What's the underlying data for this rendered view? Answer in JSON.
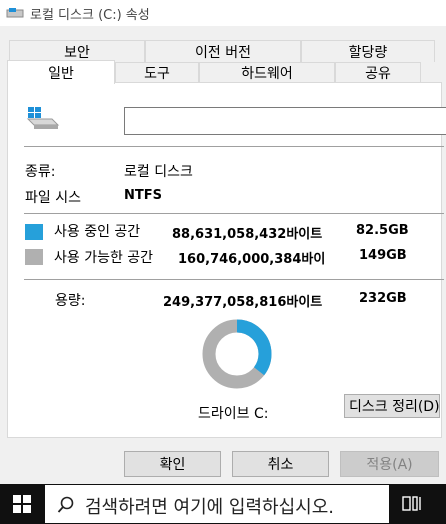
{
  "window": {
    "title": "로컬 디스크 (C:) 속성"
  },
  "tabs_back": [
    "보안",
    "이전 버전",
    "할당량"
  ],
  "tabs_front": [
    "일반",
    "도구",
    "하드웨어",
    "공유"
  ],
  "general": {
    "name_value": "",
    "type_label": "종류:",
    "type_value": "로컬 디스크",
    "fs_label": "파일 시스",
    "fs_value": "NTFS",
    "used_label": "사용 중인 공간",
    "used_bytes": "88,631,058,432바이트",
    "used_size": "82.5GB",
    "free_label": "사용 가능한 공간",
    "free_bytes": "160,746,000,384바이",
    "free_size": "149GB",
    "capacity_label": "용량:",
    "capacity_bytes": "249,377,058,816바이트",
    "capacity_size": "232GB",
    "drive_label": "드라이브 C:",
    "cleanup_button": "디스크 정리(D)",
    "used_fraction": 0.355
  },
  "buttons": {
    "ok": "확인",
    "cancel": "취소",
    "apply": "적용(A)"
  },
  "taskbar": {
    "search_placeholder": "검색하려면 여기에 입력하십시오."
  },
  "colors": {
    "used": "#26a0da",
    "free": "#b0b0b0",
    "accent": "#0078d7"
  }
}
